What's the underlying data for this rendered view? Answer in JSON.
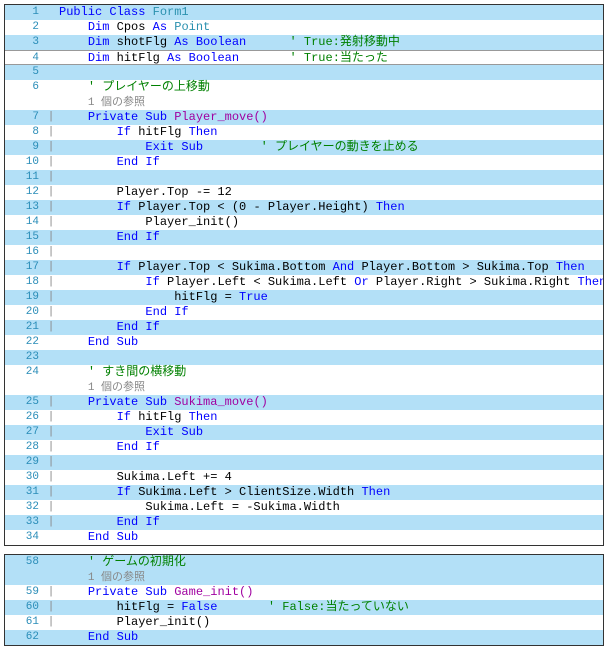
{
  "block1": {
    "lines": [
      {
        "n": 1,
        "o": "",
        "stripe": "blue",
        "tokens": [
          {
            "t": "Public Class ",
            "c": "kw"
          },
          {
            "t": "Form1",
            "c": "type"
          }
        ]
      },
      {
        "n": 2,
        "o": "",
        "stripe": "white",
        "tokens": [
          {
            "t": "    ",
            "c": ""
          },
          {
            "t": "Dim ",
            "c": "kw"
          },
          {
            "t": "Cpos ",
            "c": ""
          },
          {
            "t": "As ",
            "c": "kw"
          },
          {
            "t": "Point",
            "c": "type"
          }
        ]
      },
      {
        "n": 3,
        "o": "",
        "stripe": "blue",
        "tokens": [
          {
            "t": "    ",
            "c": ""
          },
          {
            "t": "Dim ",
            "c": "kw"
          },
          {
            "t": "shotFlg ",
            "c": ""
          },
          {
            "t": "As Boolean",
            "c": "kw"
          },
          {
            "t": "      ",
            "c": ""
          },
          {
            "t": "' True:発射移動中",
            "c": "comment"
          }
        ]
      },
      {
        "n": 4,
        "o": "",
        "stripe": "white",
        "current": true,
        "tokens": [
          {
            "t": "    ",
            "c": ""
          },
          {
            "t": "Dim ",
            "c": "kw"
          },
          {
            "t": "hitFlg ",
            "c": ""
          },
          {
            "t": "As Boolean",
            "c": "kw"
          },
          {
            "t": "       ",
            "c": ""
          },
          {
            "t": "' True:当たった",
            "c": "comment"
          }
        ]
      },
      {
        "n": 5,
        "o": "",
        "stripe": "blue",
        "tokens": []
      },
      {
        "n": 6,
        "o": "",
        "stripe": "white",
        "tokens": [
          {
            "t": "    ",
            "c": ""
          },
          {
            "t": "' プレイヤーの上移動",
            "c": "comment"
          }
        ]
      },
      {
        "n": "",
        "o": "",
        "stripe": "white",
        "tokens": [
          {
            "t": "    ",
            "c": ""
          },
          {
            "t": "1 個の参照",
            "c": "codelens"
          }
        ]
      },
      {
        "n": 7,
        "o": "|",
        "stripe": "blue",
        "tokens": [
          {
            "t": "    ",
            "c": ""
          },
          {
            "t": "Private Sub ",
            "c": "kw"
          },
          {
            "t": "Player_move()",
            "c": "member"
          }
        ]
      },
      {
        "n": 8,
        "o": "|",
        "stripe": "white",
        "tokens": [
          {
            "t": "        ",
            "c": ""
          },
          {
            "t": "If ",
            "c": "kw"
          },
          {
            "t": "hitFlg ",
            "c": ""
          },
          {
            "t": "Then",
            "c": "kw"
          }
        ]
      },
      {
        "n": 9,
        "o": "|",
        "stripe": "blue",
        "tokens": [
          {
            "t": "            ",
            "c": ""
          },
          {
            "t": "Exit Sub",
            "c": "kw"
          },
          {
            "t": "        ",
            "c": ""
          },
          {
            "t": "' プレイヤーの動きを止める",
            "c": "comment"
          }
        ]
      },
      {
        "n": 10,
        "o": "|",
        "stripe": "white",
        "tokens": [
          {
            "t": "        ",
            "c": ""
          },
          {
            "t": "End If",
            "c": "kw"
          }
        ]
      },
      {
        "n": 11,
        "o": "|",
        "stripe": "blue",
        "tokens": []
      },
      {
        "n": 12,
        "o": "|",
        "stripe": "white",
        "tokens": [
          {
            "t": "        Player.Top -= 12",
            "c": ""
          }
        ]
      },
      {
        "n": 13,
        "o": "|",
        "stripe": "blue",
        "tokens": [
          {
            "t": "        ",
            "c": ""
          },
          {
            "t": "If ",
            "c": "kw"
          },
          {
            "t": "Player.Top < (0 - Player.Height) ",
            "c": ""
          },
          {
            "t": "Then",
            "c": "kw"
          }
        ]
      },
      {
        "n": 14,
        "o": "|",
        "stripe": "white",
        "tokens": [
          {
            "t": "            Player_init()",
            "c": ""
          }
        ]
      },
      {
        "n": 15,
        "o": "|",
        "stripe": "blue",
        "tokens": [
          {
            "t": "        ",
            "c": ""
          },
          {
            "t": "End If",
            "c": "kw"
          }
        ]
      },
      {
        "n": 16,
        "o": "|",
        "stripe": "white",
        "tokens": []
      },
      {
        "n": 17,
        "o": "|",
        "stripe": "blue",
        "tokens": [
          {
            "t": "        ",
            "c": ""
          },
          {
            "t": "If ",
            "c": "kw"
          },
          {
            "t": "Player.Top < Sukima.Bottom ",
            "c": ""
          },
          {
            "t": "And ",
            "c": "kw"
          },
          {
            "t": "Player.Bottom > Sukima.Top ",
            "c": ""
          },
          {
            "t": "Then",
            "c": "kw"
          }
        ]
      },
      {
        "n": 18,
        "o": "|",
        "stripe": "white",
        "tokens": [
          {
            "t": "            ",
            "c": ""
          },
          {
            "t": "If ",
            "c": "kw"
          },
          {
            "t": "Player.Left < Sukima.Left ",
            "c": ""
          },
          {
            "t": "Or ",
            "c": "kw"
          },
          {
            "t": "Player.Right > Sukima.Right ",
            "c": ""
          },
          {
            "t": "Then",
            "c": "kw"
          }
        ]
      },
      {
        "n": 19,
        "o": "|",
        "stripe": "blue",
        "tokens": [
          {
            "t": "                hitFlg = ",
            "c": ""
          },
          {
            "t": "True",
            "c": "kw"
          }
        ]
      },
      {
        "n": 20,
        "o": "|",
        "stripe": "white",
        "tokens": [
          {
            "t": "            ",
            "c": ""
          },
          {
            "t": "End If",
            "c": "kw"
          }
        ]
      },
      {
        "n": 21,
        "o": "|",
        "stripe": "blue",
        "tokens": [
          {
            "t": "        ",
            "c": ""
          },
          {
            "t": "End If",
            "c": "kw"
          }
        ]
      },
      {
        "n": 22,
        "o": "",
        "stripe": "white",
        "tokens": [
          {
            "t": "    ",
            "c": ""
          },
          {
            "t": "End Sub",
            "c": "kw"
          }
        ]
      },
      {
        "n": 23,
        "o": "",
        "stripe": "blue",
        "tokens": []
      },
      {
        "n": 24,
        "o": "",
        "stripe": "white",
        "tokens": [
          {
            "t": "    ",
            "c": ""
          },
          {
            "t": "' すき間の横移動",
            "c": "comment"
          }
        ]
      },
      {
        "n": "",
        "o": "",
        "stripe": "white",
        "tokens": [
          {
            "t": "    ",
            "c": ""
          },
          {
            "t": "1 個の参照",
            "c": "codelens"
          }
        ]
      },
      {
        "n": 25,
        "o": "|",
        "stripe": "blue",
        "tokens": [
          {
            "t": "    ",
            "c": ""
          },
          {
            "t": "Private Sub ",
            "c": "kw"
          },
          {
            "t": "Sukima_move()",
            "c": "member"
          }
        ]
      },
      {
        "n": 26,
        "o": "|",
        "stripe": "white",
        "tokens": [
          {
            "t": "        ",
            "c": ""
          },
          {
            "t": "If ",
            "c": "kw"
          },
          {
            "t": "hitFlg ",
            "c": ""
          },
          {
            "t": "Then",
            "c": "kw"
          }
        ]
      },
      {
        "n": 27,
        "o": "|",
        "stripe": "blue",
        "tokens": [
          {
            "t": "            ",
            "c": ""
          },
          {
            "t": "Exit Sub",
            "c": "kw"
          }
        ]
      },
      {
        "n": 28,
        "o": "|",
        "stripe": "white",
        "tokens": [
          {
            "t": "        ",
            "c": ""
          },
          {
            "t": "End If",
            "c": "kw"
          }
        ]
      },
      {
        "n": 29,
        "o": "|",
        "stripe": "blue",
        "tokens": []
      },
      {
        "n": 30,
        "o": "|",
        "stripe": "white",
        "tokens": [
          {
            "t": "        Sukima.Left += 4",
            "c": ""
          }
        ]
      },
      {
        "n": 31,
        "o": "|",
        "stripe": "blue",
        "tokens": [
          {
            "t": "        ",
            "c": ""
          },
          {
            "t": "If ",
            "c": "kw"
          },
          {
            "t": "Sukima.Left > ClientSize.Width ",
            "c": ""
          },
          {
            "t": "Then",
            "c": "kw"
          }
        ]
      },
      {
        "n": 32,
        "o": "|",
        "stripe": "white",
        "tokens": [
          {
            "t": "            Sukima.Left = -Sukima.Width",
            "c": ""
          }
        ]
      },
      {
        "n": 33,
        "o": "|",
        "stripe": "blue",
        "tokens": [
          {
            "t": "        ",
            "c": ""
          },
          {
            "t": "End If",
            "c": "kw"
          }
        ]
      },
      {
        "n": 34,
        "o": "",
        "stripe": "white",
        "tokens": [
          {
            "t": "    ",
            "c": ""
          },
          {
            "t": "End Sub",
            "c": "kw"
          }
        ]
      }
    ]
  },
  "block2": {
    "lines": [
      {
        "n": 58,
        "o": "",
        "stripe": "blue",
        "tokens": [
          {
            "t": "    ",
            "c": ""
          },
          {
            "t": "' ゲームの初期化",
            "c": "comment"
          }
        ]
      },
      {
        "n": "",
        "o": "",
        "stripe": "blue",
        "tokens": [
          {
            "t": "    ",
            "c": ""
          },
          {
            "t": "1 個の参照",
            "c": "codelens"
          }
        ]
      },
      {
        "n": 59,
        "o": "|",
        "stripe": "white",
        "tokens": [
          {
            "t": "    ",
            "c": ""
          },
          {
            "t": "Private Sub ",
            "c": "kw"
          },
          {
            "t": "Game_init()",
            "c": "member"
          }
        ]
      },
      {
        "n": 60,
        "o": "|",
        "stripe": "blue",
        "tokens": [
          {
            "t": "        hitFlg = ",
            "c": ""
          },
          {
            "t": "False",
            "c": "kw"
          },
          {
            "t": "       ",
            "c": ""
          },
          {
            "t": "' False:当たっていない",
            "c": "comment"
          }
        ]
      },
      {
        "n": 61,
        "o": "|",
        "stripe": "white",
        "tokens": [
          {
            "t": "        Player_init()",
            "c": ""
          }
        ]
      },
      {
        "n": 62,
        "o": "",
        "stripe": "blue",
        "tokens": [
          {
            "t": "    ",
            "c": ""
          },
          {
            "t": "End Sub",
            "c": "kw"
          }
        ]
      }
    ]
  }
}
